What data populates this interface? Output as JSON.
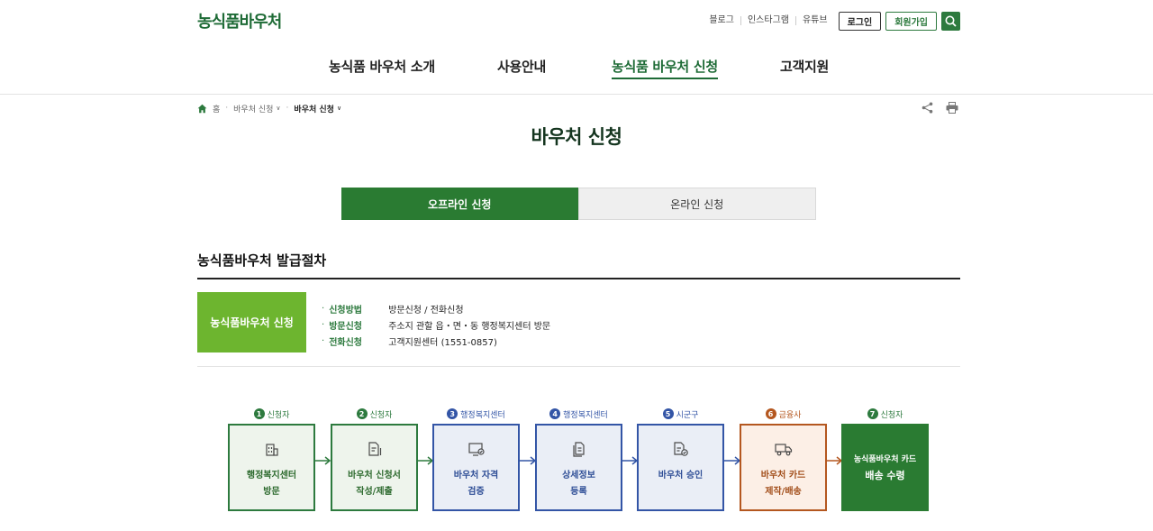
{
  "header": {
    "logo": "농식품바우처",
    "util_links": [
      "블로그",
      "인스타그램",
      "유튜브"
    ],
    "login_label": "로그인",
    "join_label": "회원가입",
    "search_icon": "search-icon"
  },
  "nav": {
    "items": [
      {
        "label": "농식품 바우처 소개"
      },
      {
        "label": "사용안내"
      },
      {
        "label": "농식품 바우처 신청"
      },
      {
        "label": "고객지원"
      }
    ],
    "active_index": 2
  },
  "breadcrumb": {
    "home": "홈",
    "level1": "바우처 신청",
    "level2": "바우처 신청"
  },
  "page_title": "바우처 신청",
  "tabs": {
    "offline": "오프라인 신청",
    "online": "온라인 신청",
    "active": "offline"
  },
  "section": {
    "title": "농식품바우처 발급절차",
    "apply_box": "농식품바우처 신청",
    "info": [
      {
        "label": "신청방법",
        "value": "방문신청 / 전화신청"
      },
      {
        "label": "방문신청",
        "value": "주소지 관할 읍・면・동 행정복지센터 방문"
      },
      {
        "label": "전화신청",
        "value": "고객지원센터 (1551-0857)"
      }
    ]
  },
  "steps": [
    {
      "num": "1",
      "who": "신청자",
      "line1": "행정복지센터",
      "line2": "방문",
      "icon": "building-icon"
    },
    {
      "num": "2",
      "who": "신청자",
      "line1": "바우처 신청서",
      "line2": "작성/제출",
      "icon": "document-pen-icon"
    },
    {
      "num": "3",
      "who": "행정복지센터",
      "line1": "바우처 자격",
      "line2": "검증",
      "icon": "monitor-check-icon"
    },
    {
      "num": "4",
      "who": "행정복지센터",
      "line1": "상세정보",
      "line2": "등록",
      "icon": "documents-icon"
    },
    {
      "num": "5",
      "who": "시군구",
      "line1": "바우처 승인",
      "line2": "",
      "icon": "document-approve-icon"
    },
    {
      "num": "6",
      "who": "금융사",
      "line1": "바우처 카드",
      "line2": "제작/배송",
      "icon": "truck-icon"
    },
    {
      "num": "7",
      "who": "신청자",
      "line1": "농식품바우처 카드",
      "line2": "배송 수령",
      "icon": ""
    }
  ],
  "colors": {
    "brand_green": "#2d7a3e",
    "apply_green": "#6db52f",
    "step_blue": "#3355a6",
    "step_orange": "#b4571f"
  }
}
